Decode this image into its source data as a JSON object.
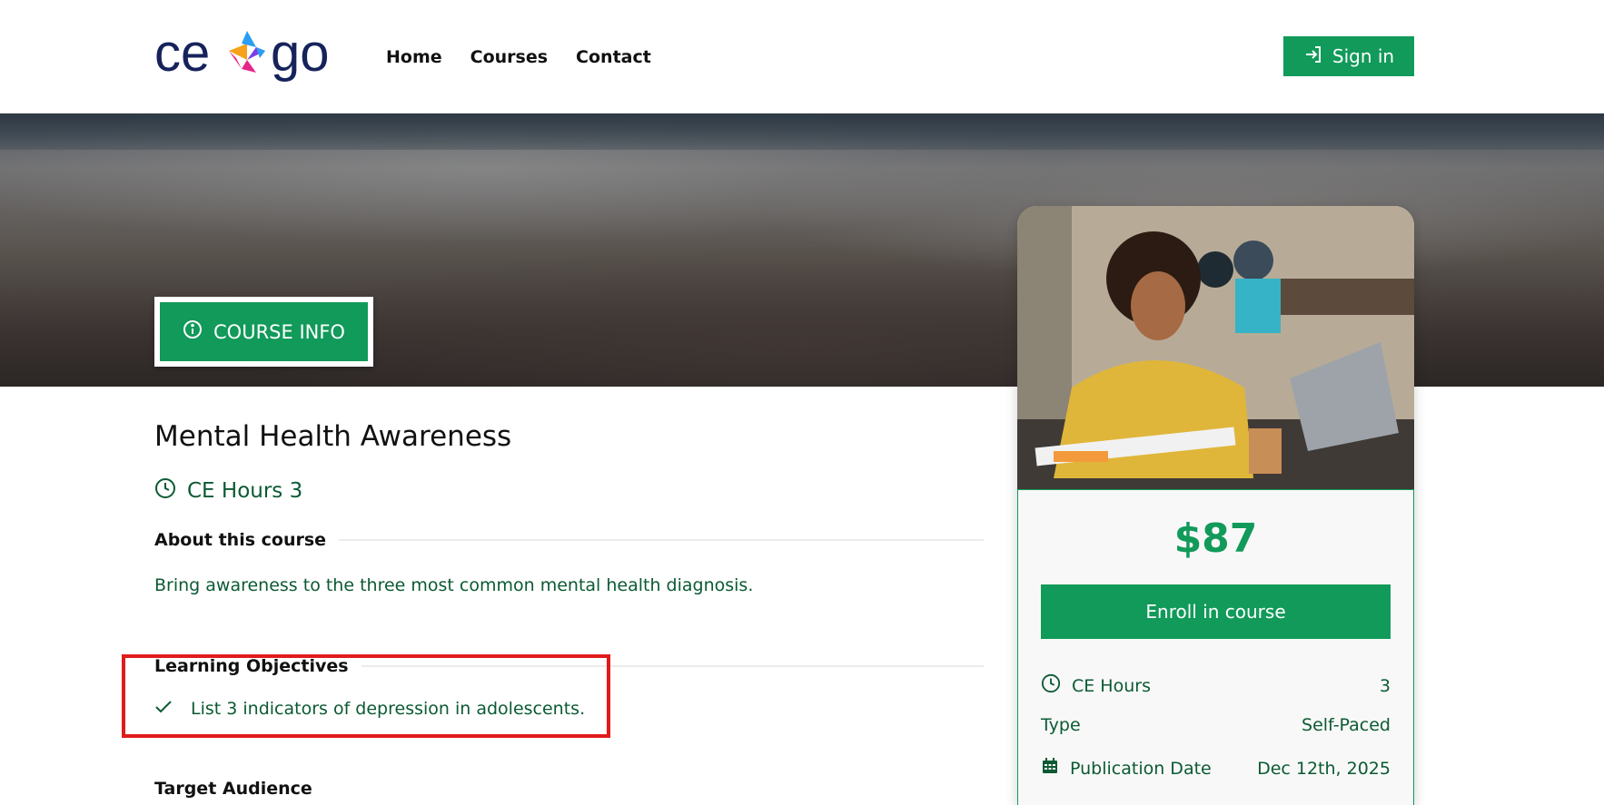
{
  "header": {
    "logo_alt": "ce go",
    "nav": [
      "Home",
      "Courses",
      "Contact"
    ],
    "signin_label": "Sign in"
  },
  "hero": {
    "course_info_label": "COURSE INFO"
  },
  "course": {
    "title": "Mental Health Awareness",
    "ce_hours_label": "CE Hours 3",
    "about_heading": "About this course",
    "about_text": "Bring awareness to the three most common mental health diagnosis.",
    "objectives_heading": "Learning Objectives",
    "objectives": [
      "List 3 indicators of depression in adolescents."
    ],
    "target_heading": "Target Audience"
  },
  "card": {
    "price": "$87",
    "enroll_label": "Enroll in course",
    "details": [
      {
        "label": "CE Hours",
        "value": "3",
        "icon": "clock-icon"
      },
      {
        "label": "Type",
        "value": "Self-Paced",
        "icon": ""
      },
      {
        "label": "Publication Date",
        "value": "Dec 12th, 2025",
        "icon": "calendar-icon"
      }
    ]
  },
  "colors": {
    "brand_green": "#119a59",
    "text_green": "#0b5a33",
    "highlight_red": "#e01b1b",
    "logo_navy": "#16235b"
  }
}
